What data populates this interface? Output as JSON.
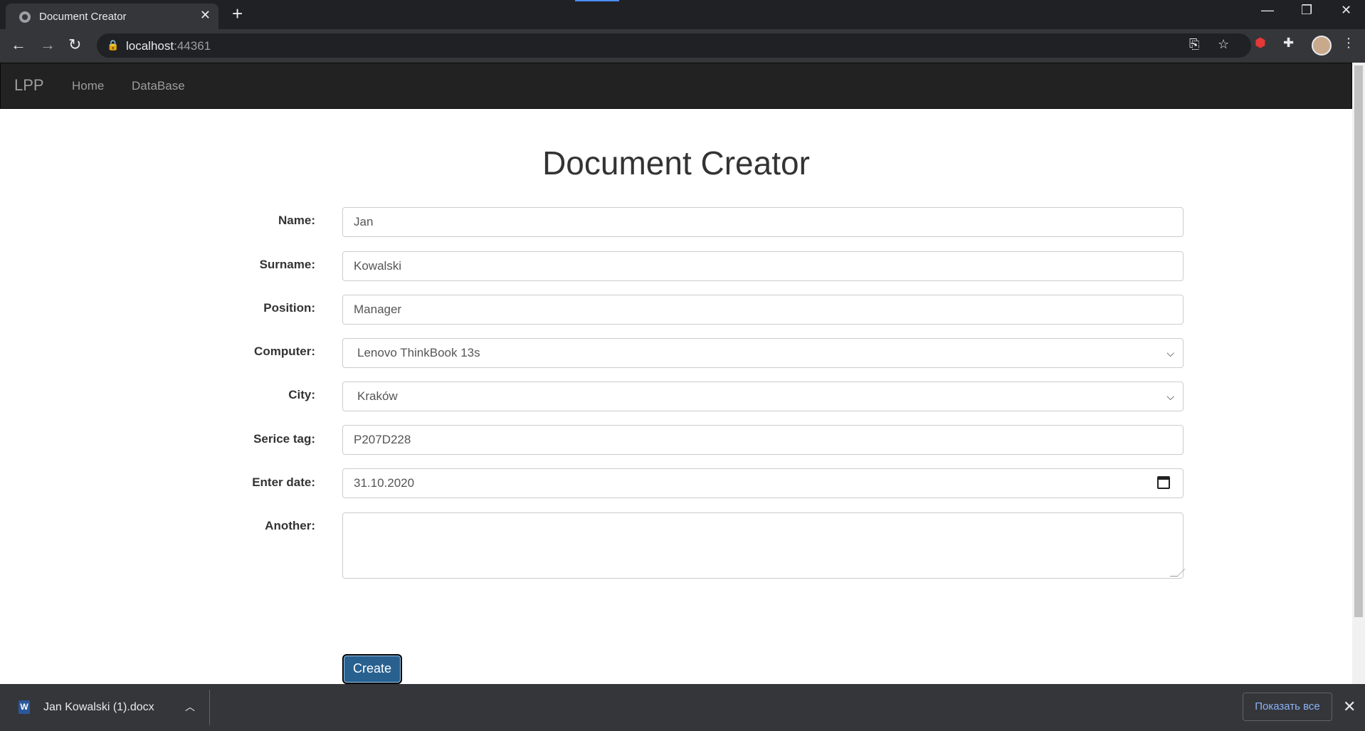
{
  "browser": {
    "tab_title": "Document Creator",
    "url_host": "localhost",
    "url_port": ":44361"
  },
  "navbar": {
    "brand": "LPP",
    "links": [
      "Home",
      "DataBase"
    ]
  },
  "form": {
    "title": "Document Creator",
    "fields": {
      "name": {
        "label": "Name:",
        "value": "Jan"
      },
      "surname": {
        "label": "Surname:",
        "value": "Kowalski"
      },
      "position": {
        "label": "Position:",
        "value": "Manager"
      },
      "computer": {
        "label": "Computer:",
        "value": "Lenovo ThinkBook 13s"
      },
      "city": {
        "label": "City:",
        "value": "Kraków"
      },
      "service_tag": {
        "label": "Serice tag:",
        "value": "P207D228"
      },
      "enter_date": {
        "label": "Enter date:",
        "value": "31.10.2020"
      },
      "another": {
        "label": "Another:",
        "value": ""
      }
    },
    "submit_label": "Create"
  },
  "download_shelf": {
    "file_name": "Jan Kowalski (1).docx",
    "show_all_label": "Показать все"
  }
}
